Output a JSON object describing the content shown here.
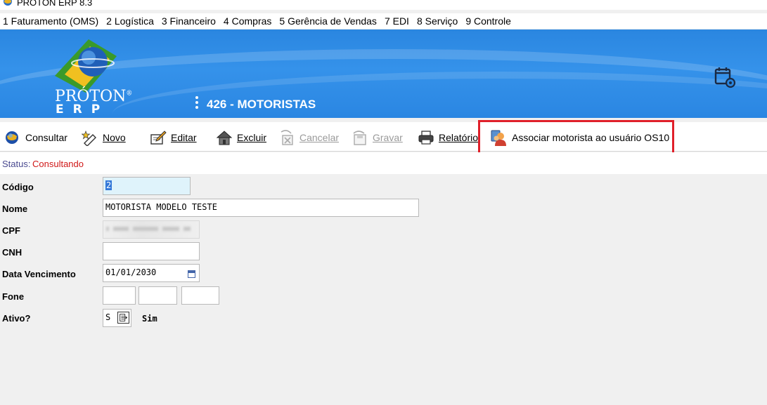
{
  "window": {
    "title": "PRÓTON ERP 8.3"
  },
  "menu": [
    "1 Faturamento (OMS)",
    "2 Logística",
    "3 Financeiro",
    "4 Compras",
    "5 Gerência de Vendas",
    "7 EDI",
    "8 Serviço",
    "9 Controle"
  ],
  "banner": {
    "logo_line1": "PRÓTON",
    "logo_registered": "®",
    "logo_line2": "ERP",
    "screen_title": "426 - MOTORISTAS",
    "colors": {
      "banner": "#2a86e0",
      "logo_green": "#3a9a2a",
      "logo_yellow": "#f0c020"
    }
  },
  "toolbar": {
    "consultar": "Consultar",
    "novo": "Novo",
    "editar": "Editar",
    "excluir": "Excluir",
    "cancelar": "Cancelar",
    "gravar": "Gravar",
    "relatorio": "Relatório",
    "associar": "Associar motorista ao usuário OS10",
    "highlight_color": "#e0202a"
  },
  "status": {
    "label": "Status:",
    "value": "Consultando"
  },
  "form": {
    "codigo": {
      "label": "Código",
      "value": "2"
    },
    "nome": {
      "label": "Nome",
      "value": "MOTORISTA MODELO TESTE"
    },
    "cpf": {
      "label": "CPF",
      "value": ""
    },
    "cnh": {
      "label": "CNH",
      "value": ""
    },
    "data_vencimento": {
      "label": "Data Vencimento",
      "value": "01/01/2030"
    },
    "fone": {
      "label": "Fone",
      "value_ddd": "",
      "value_prefix": "",
      "value_number": ""
    },
    "ativo": {
      "label": "Ativo?",
      "value": "S",
      "description": "Sim"
    }
  }
}
